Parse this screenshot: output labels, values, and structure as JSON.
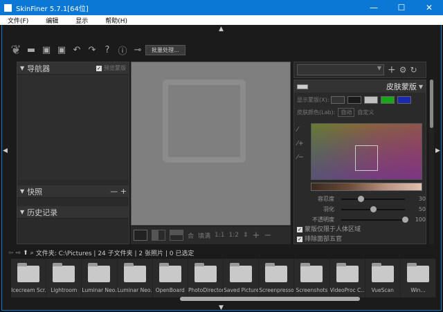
{
  "window": {
    "title": "SkinFiner 5.7.1[64位]",
    "minimize": "—",
    "maximize": "☐",
    "close": "✕"
  },
  "menu": [
    "文件(F)",
    "编辑",
    "显示",
    "帮助(H)"
  ],
  "toolbar": {
    "batch_label": "批量处理..."
  },
  "left": {
    "navigator": "导航器",
    "preview_mask": "预览蒙版",
    "snapshots": "快照",
    "snap_controls": "— +",
    "history": "历史记录"
  },
  "view_toolbar": {
    "fit": "合",
    "fill": "填满",
    "ratio1": "1:1",
    "ratio2": "1:2"
  },
  "right": {
    "preset_value": "",
    "mask_title": "皮肤蒙版",
    "show_mask": "显示蒙版(X):",
    "skin_color": "皮肤颜色(Lab):",
    "auto": "自动",
    "custom": "自定义",
    "sliders": [
      {
        "label": "容忍度",
        "value": 30
      },
      {
        "label": "羽化",
        "value": 50
      },
      {
        "label": "不透明度",
        "value": 100
      }
    ],
    "checks": [
      "蒙版仅限于人体区域",
      "排除面部五官"
    ],
    "mask_colors": [
      "#1a1a1a",
      "#c0c0c0",
      "#1aa51a",
      "#1a2ab0"
    ]
  },
  "status": "文件夹: C:\\Pictures | 24 子文件夹 | 2 张照片 | 0 已选定",
  "folders": [
    "Icecream Scr...",
    "Lightroom",
    "Luminar Neo...",
    "Luminar Neo...",
    "OpenBoard",
    "PhotoDirector",
    "Saved Pictures",
    "Screenpresso",
    "Screenshots",
    "VideoProc C...",
    "VueScan",
    "Win..."
  ]
}
